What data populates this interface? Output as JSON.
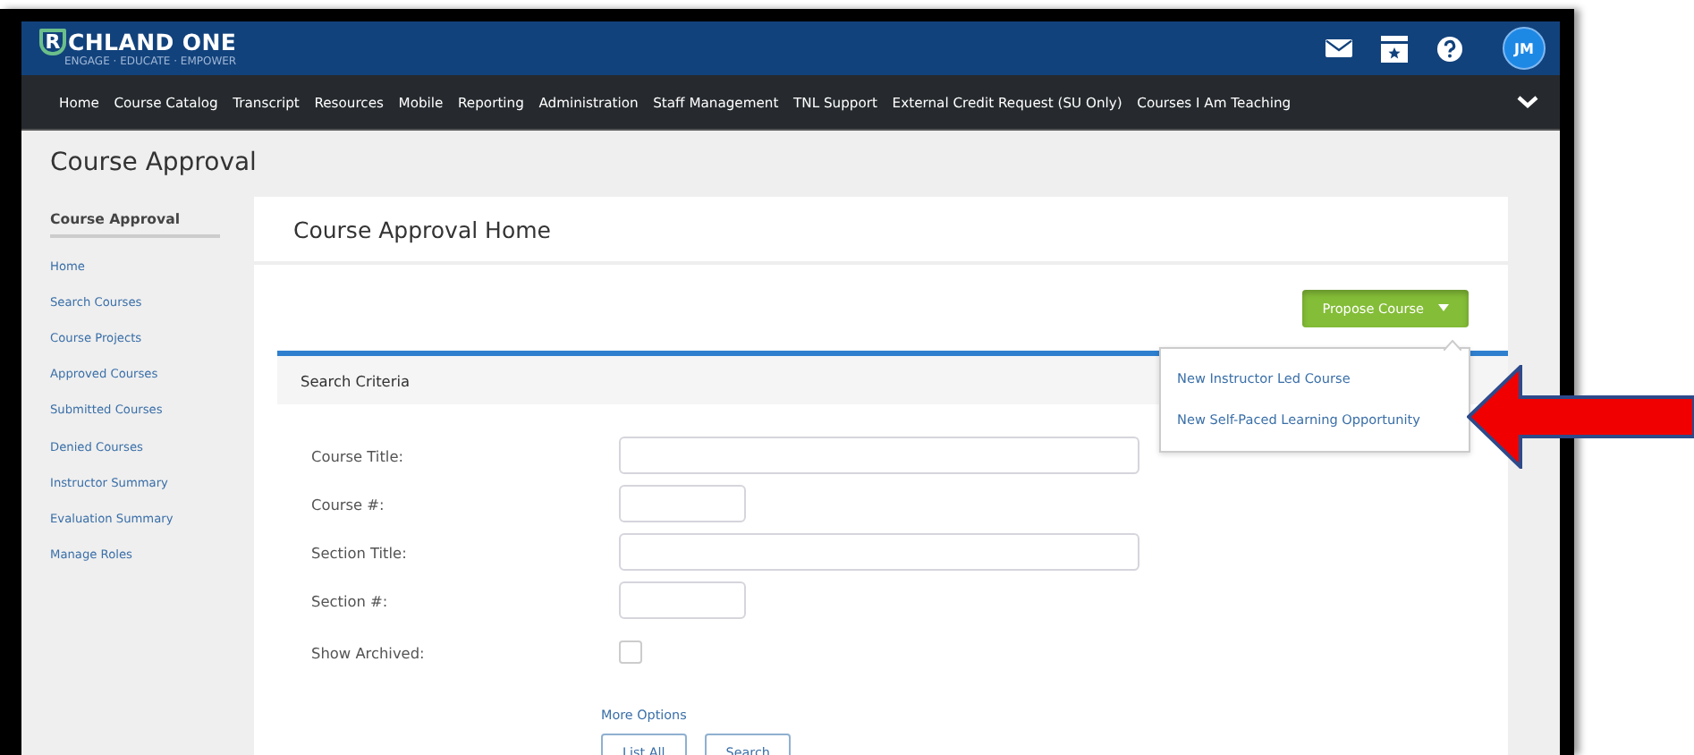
{
  "header": {
    "logo": {
      "mark": "R",
      "name": "CHLAND ONE",
      "tagline": "ENGAGE · EDUCATE · EMPOWER"
    },
    "avatar": "JM"
  },
  "nav": [
    "Home",
    "Course Catalog",
    "Transcript",
    "Resources",
    "Mobile",
    "Reporting",
    "Administration",
    "Staff Management",
    "TNL Support",
    "External Credit Request (SU Only)",
    "Courses I Am Teaching"
  ],
  "page_title": "Course Approval",
  "sidebar": {
    "title": "Course Approval",
    "items": [
      "Home",
      "Search Courses",
      "Course Projects",
      "Approved Courses",
      "Submitted Courses",
      "Denied Courses",
      "Instructor Summary",
      "Evaluation Summary",
      "Manage Roles"
    ]
  },
  "panel": {
    "title": "Course Approval Home",
    "propose": {
      "label": "Propose Course",
      "expanded": true,
      "menu": [
        "New Instructor Led Course",
        "New Self-Paced Learning Opportunity"
      ]
    },
    "search": {
      "title": "Search Criteria",
      "fields": [
        {
          "label": "Course Title:",
          "kind": "wide"
        },
        {
          "label": "Course #:",
          "kind": "short"
        },
        {
          "label": "Section Title:",
          "kind": "wide"
        },
        {
          "label": "Section #:",
          "kind": "short"
        },
        {
          "label": "Show Archived:",
          "kind": "checkbox",
          "checked": false
        }
      ],
      "more_options": "More Options",
      "buttons": [
        "List All",
        "Search"
      ]
    }
  }
}
